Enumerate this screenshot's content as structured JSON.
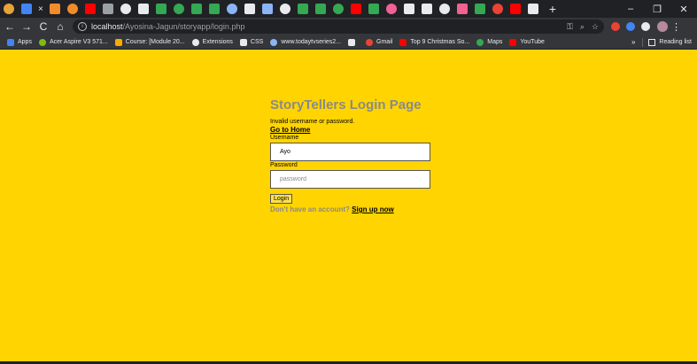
{
  "browser": {
    "tab_strip": {
      "close_glyph": "×",
      "new_tab_glyph": "+",
      "favicons": [
        {
          "icon": "triangle-favicon",
          "color": "#e8a23a"
        },
        {
          "icon": "active-tab-favicon",
          "color": "#4285f4"
        },
        {
          "icon": "orange-square-favicon",
          "color": "#f28b2c"
        },
        {
          "icon": "orange-square-favicon",
          "color": "#f28b2c"
        },
        {
          "icon": "youtube-favicon",
          "color": "#ff0000"
        },
        {
          "icon": "document-favicon",
          "color": "#9aa0a6"
        },
        {
          "icon": "chrome-favicon",
          "color": "#e8eaed"
        },
        {
          "icon": "chrome-favicon",
          "color": "#e8eaed"
        },
        {
          "icon": "w-favicon",
          "color": "#34a853"
        },
        {
          "icon": "w-favicon",
          "color": "#34a853"
        },
        {
          "icon": "w-favicon",
          "color": "#34a853"
        },
        {
          "icon": "w-favicon",
          "color": "#34a853"
        },
        {
          "icon": "shield-favicon",
          "color": "#8ab4f8"
        },
        {
          "icon": "chrome-favicon",
          "color": "#e8eaed"
        },
        {
          "icon": "film-favicon",
          "color": "#8ab4f8"
        },
        {
          "icon": "chrome-favicon",
          "color": "#e8eaed"
        },
        {
          "icon": "c-favicon",
          "color": "#34a853"
        },
        {
          "icon": "c-favicon",
          "color": "#34a853"
        },
        {
          "icon": "c-favicon",
          "color": "#34a853"
        },
        {
          "icon": "youtube-favicon",
          "color": "#ff0000"
        },
        {
          "icon": "c-favicon",
          "color": "#34a853"
        },
        {
          "icon": "pink-favicon",
          "color": "#f06292"
        },
        {
          "icon": "pin-favicon",
          "color": "#e8eaed"
        },
        {
          "icon": "pin-favicon",
          "color": "#e8eaed"
        },
        {
          "icon": "chrome-favicon",
          "color": "#e8eaed"
        },
        {
          "icon": "s-favicon",
          "color": "#f06292"
        },
        {
          "icon": "green-favicon",
          "color": "#34a853"
        },
        {
          "icon": "red-favicon",
          "color": "#ea4335"
        },
        {
          "icon": "youtube-favicon",
          "color": "#ff0000"
        },
        {
          "icon": "chrome-favicon",
          "color": "#e8eaed"
        }
      ],
      "window_controls": {
        "minimize": "–",
        "maximize": "❐",
        "close": "✕"
      }
    },
    "toolbar": {
      "back": "←",
      "forward": "→",
      "reload": "C",
      "home": "⌂",
      "info": "i",
      "url_host": "localhost",
      "url_path": "/Ayosina-Jagun/storyapp/login.php",
      "key_icon": "⚿",
      "zoom_icon": "⌕",
      "star_icon": "☆",
      "extensions": [
        {
          "icon": "adblock-icon",
          "color": "#ea4335"
        },
        {
          "icon": "colorful-extension-icon",
          "color": "#4285f4"
        },
        {
          "icon": "puzzle-icon",
          "color": "#e8eaed"
        }
      ],
      "menu": "⋮"
    },
    "bookmarks": [
      {
        "label": "Apps",
        "icon": "apps-grid-icon",
        "color": "#4285f4"
      },
      {
        "label": "Acer Aspire V3 571...",
        "icon": "acer-icon",
        "color": "#83b81a"
      },
      {
        "label": "Course: [Module 20...",
        "icon": "course-icon",
        "color": "#f9ab00"
      },
      {
        "label": "Extensions",
        "icon": "puzzle-icon",
        "color": "#e8eaed"
      },
      {
        "label": "CSS",
        "icon": "chrome-icon",
        "color": "#e8eaed"
      },
      {
        "label": "www.todaytvseries2...",
        "icon": "globe-icon",
        "color": "#8ab4f8"
      },
      {
        "label": "",
        "icon": "chrome-icon",
        "color": "#e8eaed"
      },
      {
        "label": "Gmail",
        "icon": "gmail-icon",
        "color": "#ea4335"
      },
      {
        "label": "Top 9 Christmas So...",
        "icon": "youtube-icon",
        "color": "#ff0000"
      },
      {
        "label": "Maps",
        "icon": "maps-icon",
        "color": "#34a853"
      },
      {
        "label": "YouTube",
        "icon": "youtube-icon",
        "color": "#ff0000"
      }
    ],
    "bookmarks_more": "»",
    "reading_list": "Reading list"
  },
  "page": {
    "background": "#ffd400",
    "title": "StoryTellers Login Page",
    "error_message": "Invalid username or password.",
    "home_link": "Go to Home",
    "username_label": "Username",
    "username_value": "Ayo",
    "password_label": "Password",
    "password_placeholder": "password",
    "login_button": "Login",
    "signup_prompt": "Don't have an account? ",
    "signup_link": "Sign up now"
  }
}
